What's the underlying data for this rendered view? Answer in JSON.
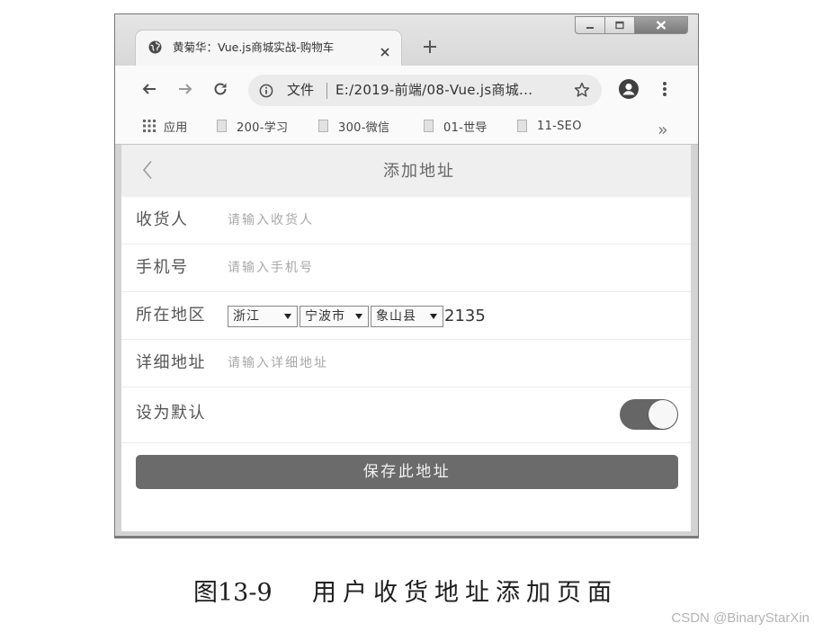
{
  "browser": {
    "window_controls": {
      "minimize_icon": "minimize-icon",
      "maximize_icon": "maximize-icon",
      "close_icon": "close-icon"
    },
    "tab": {
      "title": "黄菊华：Vue.js商城实战-购物车",
      "favicon": "globe-icon",
      "close_icon": "close-icon"
    },
    "new_tab_icon": "plus-icon",
    "toolbar": {
      "back_icon": "arrow-left-icon",
      "forward_icon": "arrow-right-icon",
      "reload_icon": "reload-icon",
      "profile_icon": "account-icon",
      "menu_icon": "more-vert-icon"
    },
    "omnibox": {
      "info_icon": "info-icon",
      "scheme_label": "文件",
      "url": "E:/2019-前端/08-Vue.js商城...",
      "bookmark_icon": "star-icon"
    },
    "bookmarks": [
      {
        "label": "应用",
        "icon": "apps-grid-icon"
      },
      {
        "label": "200-学习",
        "icon": "bookmark-page-icon"
      },
      {
        "label": "300-微信",
        "icon": "bookmark-page-icon"
      },
      {
        "label": "01-世导",
        "icon": "bookmark-page-icon"
      },
      {
        "label": "11-SEO",
        "icon": "bookmark-page-icon"
      }
    ],
    "bookmarks_more_icon": "double-chevron-right-icon"
  },
  "page": {
    "header": {
      "back_icon": "chevron-left-icon",
      "title": "添加地址"
    },
    "form": {
      "receiver": {
        "label": "收货人",
        "placeholder": "请输入收货人"
      },
      "phone": {
        "label": "手机号",
        "placeholder": "请输入手机号"
      },
      "region": {
        "label": "所在地区",
        "province": "浙江",
        "city": "宁波市",
        "county": "象山县",
        "area_code": "2135"
      },
      "detail": {
        "label": "详细地址",
        "placeholder": "请输入详细地址"
      },
      "default_address": {
        "label": "设为默认",
        "enabled": true
      }
    },
    "save_button": {
      "label": "保存此地址"
    }
  },
  "caption": {
    "figure_number": "图13-9",
    "title": "用户收货地址添加页面"
  },
  "watermark": "CSDN @BinaryStarXin",
  "colors": {
    "save_button": "#6b6b6b",
    "toggle_track_on": "#666666",
    "header_background": "#efefef"
  }
}
